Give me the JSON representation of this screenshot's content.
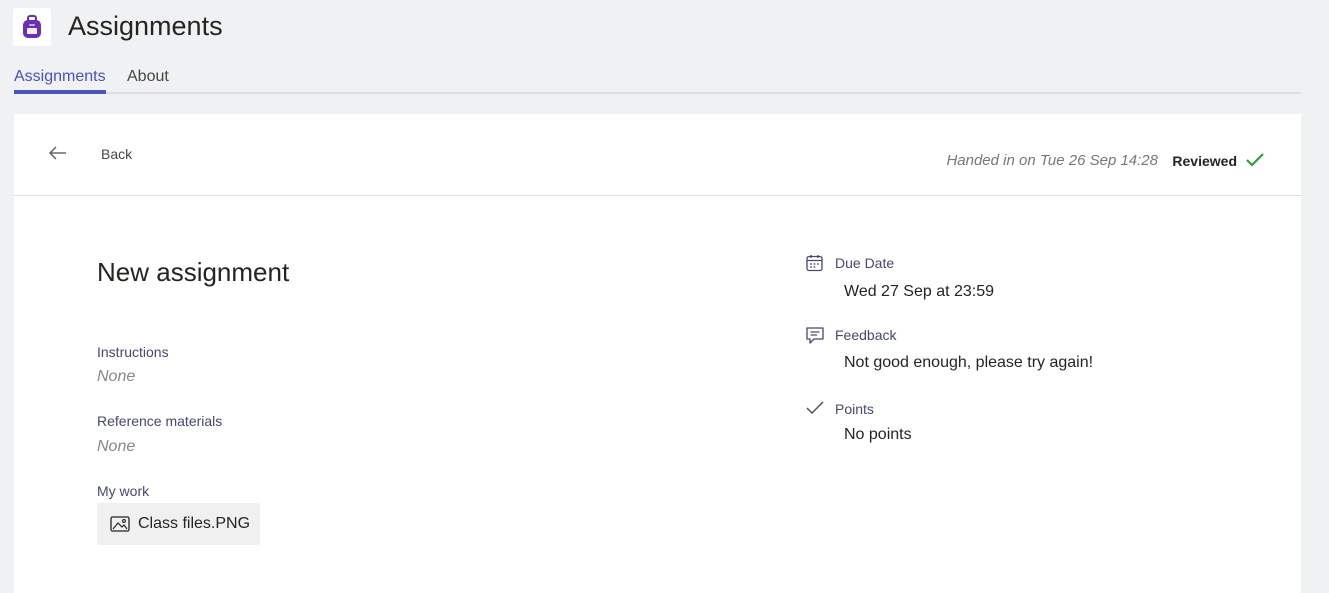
{
  "app": {
    "title": "Assignments",
    "icon": "backpack-icon",
    "accent_color": "#4b53bc",
    "icon_color": "#6b2fb3"
  },
  "tabs": [
    {
      "label": "Assignments",
      "active": true
    },
    {
      "label": "About",
      "active": false
    }
  ],
  "header": {
    "back_label": "Back",
    "handed_in_text": "Handed in on Tue 26 Sep 14:28",
    "status_label": "Reviewed",
    "status_color": "#2e9e3d"
  },
  "assignment": {
    "title": "New assignment",
    "instructions_label": "Instructions",
    "instructions_value": "None",
    "reference_label": "Reference materials",
    "reference_value": "None",
    "my_work_label": "My work",
    "attachments": [
      {
        "name": "Class files.PNG",
        "icon": "image-icon"
      }
    ]
  },
  "details": {
    "due_date_label": "Due Date",
    "due_date_value": "Wed 27 Sep at 23:59",
    "feedback_label": "Feedback",
    "feedback_value": "Not good enough, please try again!",
    "points_label": "Points",
    "points_value": "No points"
  }
}
